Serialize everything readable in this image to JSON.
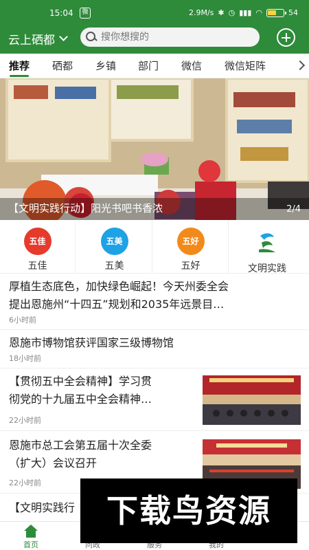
{
  "status_bar": {
    "time": "15:04",
    "notif_icon_text": "微",
    "network_speed": "2.9M/s",
    "battery": "54"
  },
  "header": {
    "city": "云上硒都",
    "search_placeholder": "搜你想搜的"
  },
  "tabs": [
    "推荐",
    "硒都",
    "乡镇",
    "部门",
    "微信",
    "微信矩阵"
  ],
  "banner": {
    "caption": "【文明实践行动】阳光书吧书香浓",
    "pager": "2/4"
  },
  "categories": [
    {
      "badge": "五佳",
      "label": "五佳",
      "color": "#e53a2c"
    },
    {
      "badge": "五美",
      "label": "五美",
      "color": "#1ea2e6"
    },
    {
      "badge": "五好",
      "label": "五好",
      "color": "#f28a1b"
    },
    {
      "badge": "",
      "label": "文明实践",
      "color": "#2e8b3a"
    }
  ],
  "news": [
    {
      "title_line1": "厚植生态底色，加快绿色崛起！今天州委全会",
      "title_line2": "提出恩施州“十四五”规划和2035年远景目…",
      "time": "6小时前"
    },
    {
      "title_line1": "恩施市博物馆获评国家三级博物馆",
      "time": "18小时前"
    },
    {
      "title_line1": "【贯彻五中全会精神】学习贯",
      "title_line2": "彻党的十九届五中全会精神…",
      "time": "22小时前"
    },
    {
      "title_line1": "恩施市总工会第五届十次全委",
      "title_line2": "（扩大）会议召开",
      "time": "22小时前"
    },
    {
      "title_line1": "【文明实践行"
    }
  ],
  "bottom_nav": [
    "首页",
    "问政",
    "服务",
    "我的"
  ],
  "watermark": "下载鸟资源",
  "colors": {
    "brand": "#2e8b3a"
  }
}
